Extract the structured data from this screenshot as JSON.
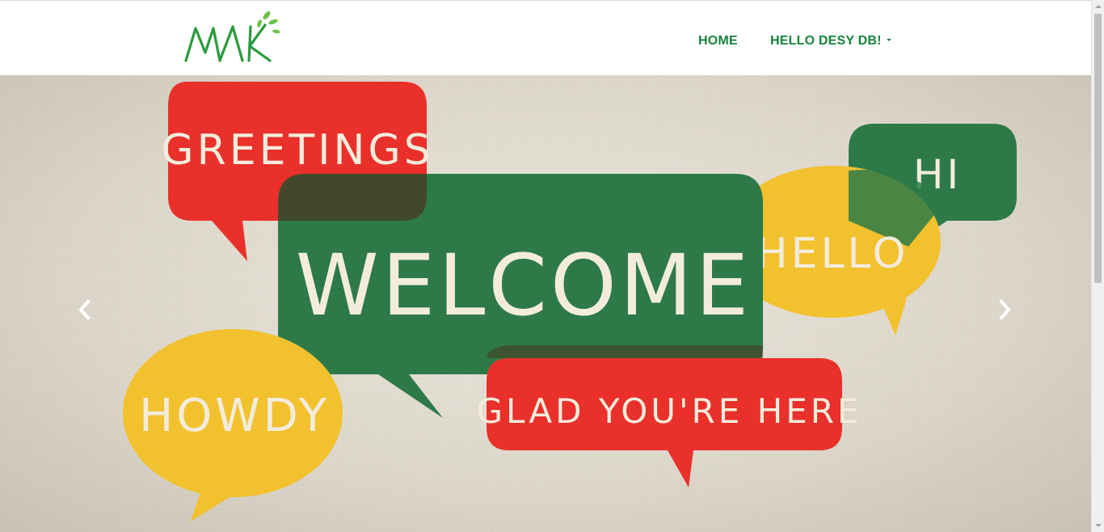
{
  "navbar": {
    "logo_text": "MAK",
    "links": [
      {
        "label": "HOME"
      },
      {
        "label": "HELLO DESY DB!"
      }
    ]
  },
  "carousel": {
    "slide": {
      "bubbles": [
        {
          "text": "GREETINGS",
          "color": "#e9302b"
        },
        {
          "text": "WELCOME",
          "color": "#2d7a48"
        },
        {
          "text": "HI",
          "color": "#2d7a48"
        },
        {
          "text": "HELLO",
          "color": "#f2c12e"
        },
        {
          "text": "HOWDY",
          "color": "#f2c12e"
        },
        {
          "text": "GLAD YOU'RE HERE",
          "color": "#e9302b"
        }
      ]
    },
    "controls": {
      "prev_icon": "chevron-left-icon",
      "next_icon": "chevron-right-icon"
    }
  },
  "colors": {
    "nav_accent": "#13843a",
    "background": "#e6e1d6"
  }
}
